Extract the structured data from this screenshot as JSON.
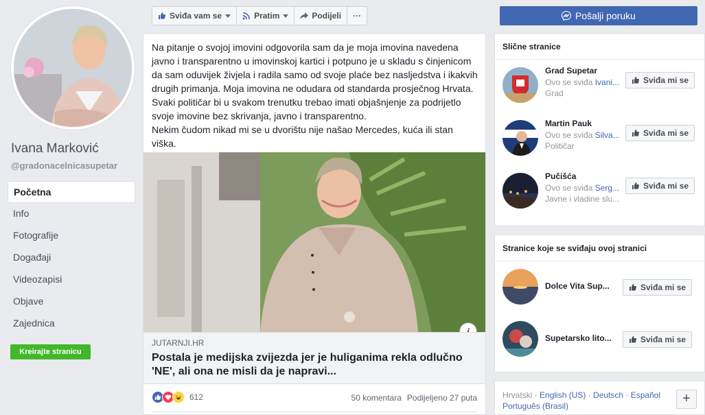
{
  "profile": {
    "name": "Ivana Marković",
    "handle": "@gradonacelnicasupetar"
  },
  "nav": {
    "items": [
      {
        "label": "Početna",
        "active": true
      },
      {
        "label": "Info"
      },
      {
        "label": "Fotografije"
      },
      {
        "label": "Događaji"
      },
      {
        "label": "Videozapisi"
      },
      {
        "label": "Objave"
      },
      {
        "label": "Zajednica"
      }
    ],
    "create_page": "Kreirajte stranicu"
  },
  "action_bar": {
    "like": "Sviđa vam se",
    "follow": "Pratim",
    "share": "Podijeli",
    "more": "···",
    "message": "Pošalji poruku"
  },
  "post": {
    "paragraph1": "Na pitanje o svojoj imovini odgovorila sam da je moja imovina navedena javno i transparentno u imovinskoj kartici i potpuno je u skladu s činjenicom da sam oduvijek živjela i radila samo od svoje plaće bez nasljedstva i ikakvih drugih primanja. Moja imovina ne odudara od standarda prosječnog Hrvata. Svaki političar bi u svakom trenutku trebao imati objašnjenje za podrijetlo svoje imovine bez skrivanja, javno i transparentno.",
    "paragraph2": "Nekim čudom nikad mi se u dvorištu nije našao Mercedes, kuća ili stan viška.",
    "link_domain": "JUTARNJI.HR",
    "link_title": "Postala je medijska zvijezda jer je huliganima rekla odlučno 'NE', ali ona ne misli da je napravi...",
    "info_badge": "i",
    "reaction_count": "612",
    "comments": "50 komentara",
    "shares": "Podijeljeno 27 puta"
  },
  "similar_pages": {
    "title": "Slične stranice",
    "items": [
      {
        "name": "Grad Supetar",
        "likes_prefix": "Ovo se sviđa",
        "liker": "Ivani...",
        "category": "Grad",
        "button": "Sviđa mi se"
      },
      {
        "name": "Martin Pauk",
        "likes_prefix": "Ovo se sviđa",
        "liker": "Silva...",
        "category": "Političar",
        "button": "Sviđa mi se"
      },
      {
        "name": "Pučišća",
        "likes_prefix": "Ovo se sviđa",
        "liker": "Serg...",
        "category": "Javne i vladine slu...",
        "button": "Sviđa mi se"
      }
    ]
  },
  "liked_pages": {
    "title": "Stranice koje se sviđaju ovoj stranici",
    "items": [
      {
        "name": "Dolce Vita Sup...",
        "button": "Sviđa mi se"
      },
      {
        "name": "Supetarsko lito...",
        "button": "Sviđa mi se"
      }
    ]
  },
  "languages": {
    "current": "Hrvatski",
    "sep": " · ",
    "others": [
      "English (US)",
      "Deutsch",
      "Español",
      "Português (Brasil)"
    ],
    "add": "+"
  },
  "colors": {
    "brand": "#4267b2",
    "green": "#42b72a",
    "background": "#e9ebee"
  }
}
